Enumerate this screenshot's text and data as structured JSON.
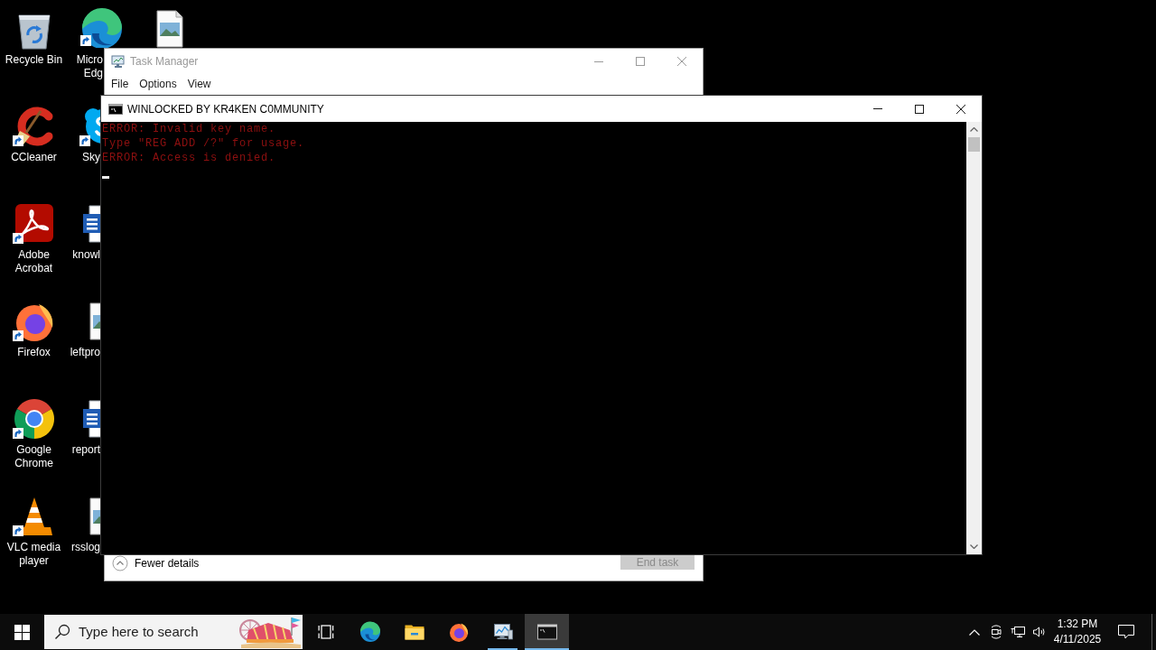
{
  "desktop": {
    "columns": [
      {
        "icons": [
          {
            "kind": "recycle-bin",
            "label_lines": [
              "Recycle Bin"
            ],
            "shortcut": false
          },
          {
            "kind": "ccleaner",
            "label_lines": [
              "CCleaner"
            ],
            "shortcut": true
          },
          {
            "kind": "acrobat",
            "label_lines": [
              "Adobe",
              "Acrobat"
            ],
            "shortcut": true
          },
          {
            "kind": "firefox",
            "label_lines": [
              "Firefox"
            ],
            "shortcut": true
          },
          {
            "kind": "chrome",
            "label_lines": [
              "Google",
              "Chrome"
            ],
            "shortcut": true
          },
          {
            "kind": "vlc",
            "label_lines": [
              "VLC media",
              "player"
            ],
            "shortcut": true
          }
        ]
      },
      {
        "icons": [
          {
            "kind": "edge",
            "label_lines": [
              "Micro",
              "Edg"
            ],
            "shortcut": true
          },
          {
            "kind": "skype",
            "label_lines": [
              "Sky"
            ],
            "shortcut": true
          },
          {
            "kind": "word-doc",
            "label_lines": [
              "knowl"
            ],
            "shortcut": false
          },
          {
            "kind": "image-file",
            "label_lines": [
              "leftpro"
            ],
            "shortcut": false
          },
          {
            "kind": "word-doc",
            "label_lines": [
              "report"
            ],
            "shortcut": false
          },
          {
            "kind": "image-file",
            "label_lines": [
              "rsslog"
            ],
            "shortcut": false
          }
        ]
      },
      {
        "icons": [
          {
            "kind": "image-file",
            "shortcut": false
          }
        ]
      }
    ]
  },
  "task_manager": {
    "title": "Task Manager",
    "active": false,
    "menu": [
      "File",
      "Options",
      "View"
    ],
    "footer": {
      "toggle": "Fewer details",
      "end_task": {
        "label": "End task",
        "disabled": true
      }
    }
  },
  "console": {
    "title": "WINLOCKED BY KR4KEN C0MMUNITY",
    "active": true,
    "lines": [
      "ERROR: Invalid key name.",
      "Type \"REG ADD /?\" for usage.",
      "ERROR: Access is denied."
    ]
  },
  "taskbar": {
    "search": {
      "placeholder": "Type here to search"
    },
    "apps": [
      {
        "kind": "task-view",
        "running": false,
        "selected": false
      },
      {
        "kind": "edge",
        "running": false,
        "selected": false
      },
      {
        "kind": "file-explorer",
        "running": false,
        "selected": false
      },
      {
        "kind": "firefox",
        "running": false,
        "selected": false
      },
      {
        "kind": "task-manager",
        "running": true,
        "selected": false
      },
      {
        "kind": "console",
        "running": true,
        "selected": true
      }
    ],
    "clock": {
      "time": "1:32 PM",
      "date": "4/11/2025"
    }
  }
}
